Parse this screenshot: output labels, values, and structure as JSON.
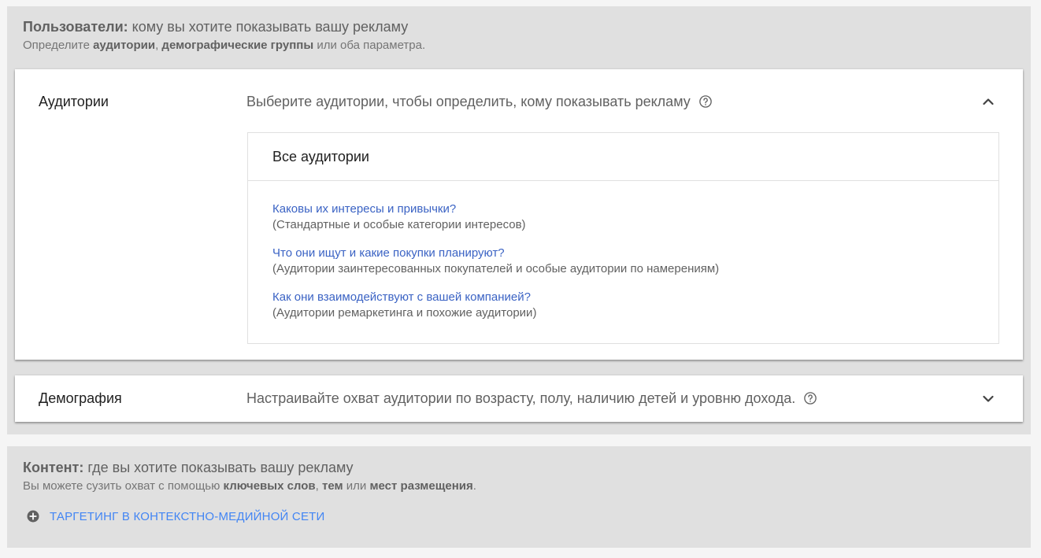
{
  "users_section": {
    "title_bold": "Пользователи:",
    "title_rest": " кому вы хотите показывать вашу рекламу",
    "sub_prefix": "Определите ",
    "sub_b1": "аудитории",
    "sub_sep": ", ",
    "sub_b2": "демографические группы",
    "sub_suffix": " или оба параметра."
  },
  "audiences": {
    "label": "Аудитории",
    "description": "Выберите аудитории, чтобы определить, кому показывать рекламу",
    "help_icon": "help-circle-icon",
    "toggle_icon": "chevron-up-icon",
    "box_title": "Все аудитории",
    "options": [
      {
        "link": "Каковы их интересы и привычки?",
        "note": "(Стандартные и особые категории интересов)"
      },
      {
        "link": "Что они ищут и какие покупки планируют?",
        "note": "(Аудитории заинтересованных покупателей и особые аудитории по намерениям)"
      },
      {
        "link": "Как они взаимодействуют с вашей компанией?",
        "note": "(Аудитории ремаркетинга и похожие аудитории)"
      }
    ]
  },
  "demography": {
    "label": "Демография",
    "description": "Настраивайте охват аудитории по возрасту, полу, наличию детей и уровню дохода.",
    "help_icon": "help-circle-icon",
    "toggle_icon": "chevron-down-icon"
  },
  "content_section": {
    "title_bold": "Контент:",
    "title_rest": " где вы хотите показывать вашу рекламу",
    "sub_prefix": "Вы можете сузить охват с помощью ",
    "sub_b1": "ключевых слов",
    "sub_sep1": ", ",
    "sub_b2": "тем",
    "sub_sep2": " или ",
    "sub_b3": "мест размещения",
    "sub_suffix": ".",
    "targeting_icon": "add-circle-icon",
    "targeting_label": "ТАРГЕТИНГ В КОНТЕКСТНО-МЕДИЙНОЙ СЕТИ"
  },
  "colors": {
    "link": "#3b63c4",
    "accent": "#4285f4",
    "panel_bg": "#e0e0e0",
    "card_bg": "#ffffff"
  }
}
